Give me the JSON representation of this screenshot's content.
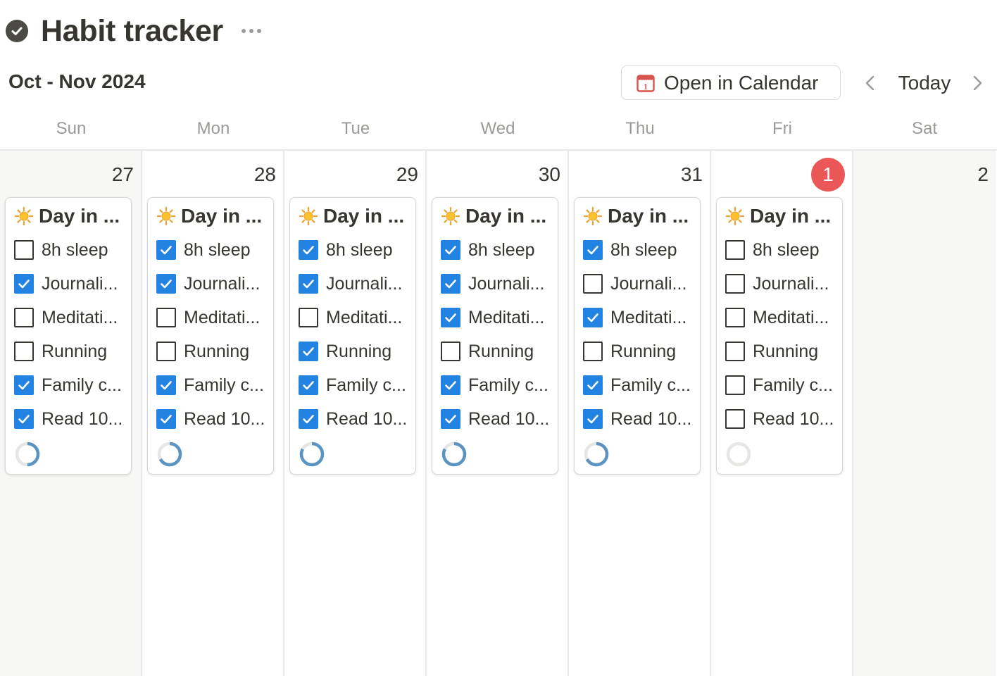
{
  "header": {
    "title": "Habit tracker",
    "month_label": "Oct - Nov 2024",
    "open_calendar_label": "Open in Calendar",
    "calendar_icon_day": "1",
    "today_label": "Today"
  },
  "weekdays": [
    "Sun",
    "Mon",
    "Tue",
    "Wed",
    "Thu",
    "Fri",
    "Sat"
  ],
  "colors": {
    "accent": "#2383e2",
    "today_badge": "#eb5757",
    "progress": "#5b93c2",
    "progress_track": "#e6e6e4"
  },
  "days": [
    {
      "date": "27",
      "weekend": true,
      "today": false,
      "card": {
        "title": "Day in ...",
        "progress": 0.5,
        "habits": [
          {
            "label": "8h sleep",
            "checked": false
          },
          {
            "label": "Journali...",
            "checked": true
          },
          {
            "label": "Meditati...",
            "checked": false
          },
          {
            "label": "Running",
            "checked": false
          },
          {
            "label": "Family c...",
            "checked": true
          },
          {
            "label": "Read 10...",
            "checked": true
          }
        ]
      }
    },
    {
      "date": "28",
      "weekend": false,
      "today": false,
      "card": {
        "title": "Day in ...",
        "progress": 0.67,
        "habits": [
          {
            "label": "8h sleep",
            "checked": true
          },
          {
            "label": "Journali...",
            "checked": true
          },
          {
            "label": "Meditati...",
            "checked": false
          },
          {
            "label": "Running",
            "checked": false
          },
          {
            "label": "Family c...",
            "checked": true
          },
          {
            "label": "Read 10...",
            "checked": true
          }
        ]
      }
    },
    {
      "date": "29",
      "weekend": false,
      "today": false,
      "card": {
        "title": "Day in ...",
        "progress": 0.83,
        "habits": [
          {
            "label": "8h sleep",
            "checked": true
          },
          {
            "label": "Journali...",
            "checked": true
          },
          {
            "label": "Meditati...",
            "checked": false
          },
          {
            "label": "Running",
            "checked": true
          },
          {
            "label": "Family c...",
            "checked": true
          },
          {
            "label": "Read 10...",
            "checked": true
          }
        ]
      }
    },
    {
      "date": "30",
      "weekend": false,
      "today": false,
      "card": {
        "title": "Day in ...",
        "progress": 0.83,
        "habits": [
          {
            "label": "8h sleep",
            "checked": true
          },
          {
            "label": "Journali...",
            "checked": true
          },
          {
            "label": "Meditati...",
            "checked": true
          },
          {
            "label": "Running",
            "checked": false
          },
          {
            "label": "Family c...",
            "checked": true
          },
          {
            "label": "Read 10...",
            "checked": true
          }
        ]
      }
    },
    {
      "date": "31",
      "weekend": false,
      "today": false,
      "card": {
        "title": "Day in ...",
        "progress": 0.67,
        "habits": [
          {
            "label": "8h sleep",
            "checked": true
          },
          {
            "label": "Journali...",
            "checked": false
          },
          {
            "label": "Meditati...",
            "checked": true
          },
          {
            "label": "Running",
            "checked": false
          },
          {
            "label": "Family c...",
            "checked": true
          },
          {
            "label": "Read 10...",
            "checked": true
          }
        ]
      }
    },
    {
      "date": "1",
      "weekend": false,
      "today": true,
      "card": {
        "title": "Day in ...",
        "progress": 0,
        "habits": [
          {
            "label": "8h sleep",
            "checked": false
          },
          {
            "label": "Journali...",
            "checked": false
          },
          {
            "label": "Meditati...",
            "checked": false
          },
          {
            "label": "Running",
            "checked": false
          },
          {
            "label": "Family c...",
            "checked": false
          },
          {
            "label": "Read 10...",
            "checked": false
          }
        ]
      }
    },
    {
      "date": "2",
      "weekend": true,
      "today": false,
      "card": null
    }
  ]
}
